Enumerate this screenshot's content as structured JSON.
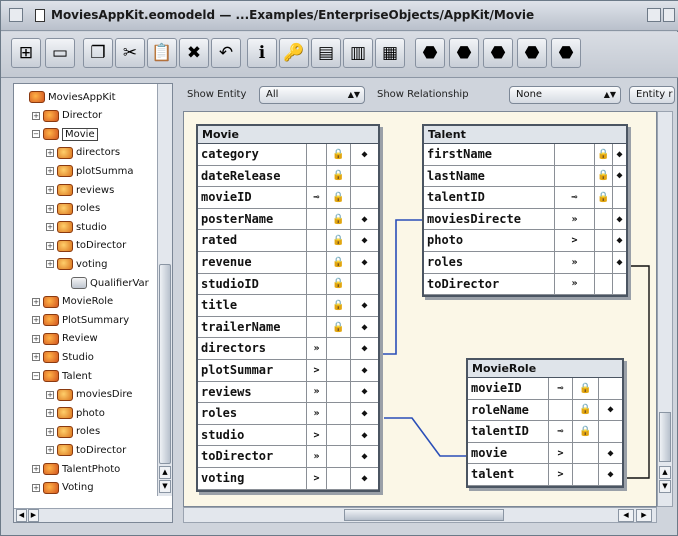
{
  "window": {
    "title": "MoviesAppKit.eomodeld — ...Examples/EnterpriseObjects/AppKit/Movie"
  },
  "toolbar": {
    "tools": [
      {
        "name": "browser-mode-icon",
        "glyph": "⊞"
      },
      {
        "name": "table-mode-icon",
        "glyph": "▭"
      },
      {
        "name": "copy-icon",
        "glyph": "❐"
      },
      {
        "name": "cut-icon",
        "glyph": "✂"
      },
      {
        "name": "paste-icon",
        "glyph": "📋"
      },
      {
        "name": "delete-icon",
        "glyph": "✖"
      },
      {
        "name": "undo-icon",
        "glyph": "↶"
      },
      {
        "name": "inspector-icon",
        "glyph": "ℹ"
      },
      {
        "name": "key-icon",
        "glyph": "🔑"
      },
      {
        "name": "table-edit-icon",
        "glyph": "▤"
      },
      {
        "name": "sql-icon",
        "glyph": "▥"
      },
      {
        "name": "data-browser-icon",
        "glyph": "▦"
      },
      {
        "name": "add-entity-icon",
        "glyph": "⬣"
      },
      {
        "name": "add-attribute-icon",
        "glyph": "⬣"
      },
      {
        "name": "add-relationship-icon",
        "glyph": "⬣"
      },
      {
        "name": "flatten-icon",
        "glyph": "⬣"
      },
      {
        "name": "fetch-spec-icon",
        "glyph": "⬣"
      }
    ]
  },
  "filters": {
    "entity_label": "Show Entity",
    "entity_value": "All",
    "relationship_label": "Show Relationship",
    "relationship_value": "None",
    "extra_value": "Entity r"
  },
  "tree": [
    {
      "label": "MoviesAppKit",
      "indent": 0,
      "exp": "",
      "icon": "model"
    },
    {
      "label": "Director",
      "indent": 1,
      "exp": "+",
      "icon": "entity"
    },
    {
      "label": "Movie",
      "indent": 1,
      "exp": "−",
      "icon": "entity",
      "selected": true
    },
    {
      "label": "directors",
      "indent": 2,
      "exp": "+",
      "icon": "attr"
    },
    {
      "label": "plotSumma",
      "indent": 2,
      "exp": "+",
      "icon": "attr"
    },
    {
      "label": "reviews",
      "indent": 2,
      "exp": "+",
      "icon": "attr"
    },
    {
      "label": "roles",
      "indent": 2,
      "exp": "+",
      "icon": "attr"
    },
    {
      "label": "studio",
      "indent": 2,
      "exp": "+",
      "icon": "attr"
    },
    {
      "label": "toDirector",
      "indent": 2,
      "exp": "+",
      "icon": "attr"
    },
    {
      "label": "voting",
      "indent": 2,
      "exp": "+",
      "icon": "attr"
    },
    {
      "label": "QualifierVar",
      "indent": 3,
      "exp": "",
      "icon": "qual"
    },
    {
      "label": "MovieRole",
      "indent": 1,
      "exp": "+",
      "icon": "entity"
    },
    {
      "label": "PlotSummary",
      "indent": 1,
      "exp": "+",
      "icon": "entity"
    },
    {
      "label": "Review",
      "indent": 1,
      "exp": "+",
      "icon": "entity"
    },
    {
      "label": "Studio",
      "indent": 1,
      "exp": "+",
      "icon": "entity"
    },
    {
      "label": "Talent",
      "indent": 1,
      "exp": "−",
      "icon": "entity"
    },
    {
      "label": "moviesDire",
      "indent": 2,
      "exp": "+",
      "icon": "attr"
    },
    {
      "label": "photo",
      "indent": 2,
      "exp": "+",
      "icon": "attr"
    },
    {
      "label": "roles",
      "indent": 2,
      "exp": "+",
      "icon": "attr"
    },
    {
      "label": "toDirector",
      "indent": 2,
      "exp": "+",
      "icon": "attr"
    },
    {
      "label": "TalentPhoto",
      "indent": 1,
      "exp": "+",
      "icon": "entity"
    },
    {
      "label": "Voting",
      "indent": 1,
      "exp": "+",
      "icon": "entity"
    }
  ],
  "entities": [
    {
      "id": "movie",
      "name": "Movie",
      "rows": [
        {
          "name": "category",
          "key": "",
          "lock": "🔒",
          "prop": "◆"
        },
        {
          "name": "dateRelease",
          "key": "",
          "lock": "🔒",
          "prop": ""
        },
        {
          "name": "movieID",
          "key": "⊸",
          "lock": "🔒",
          "prop": ""
        },
        {
          "name": "posterName",
          "key": "",
          "lock": "🔒",
          "prop": "◆"
        },
        {
          "name": "rated",
          "key": "",
          "lock": "🔒",
          "prop": "◆"
        },
        {
          "name": "revenue",
          "key": "",
          "lock": "🔒",
          "prop": "◆"
        },
        {
          "name": "studioID",
          "key": "",
          "lock": "🔒",
          "prop": ""
        },
        {
          "name": "title",
          "key": "",
          "lock": "🔒",
          "prop": "◆"
        },
        {
          "name": "trailerName",
          "key": "",
          "lock": "🔒",
          "prop": "◆"
        },
        {
          "name": "directors",
          "key": "»",
          "lock": "",
          "prop": "◆"
        },
        {
          "name": "plotSummar",
          "key": ">",
          "lock": "",
          "prop": "◆"
        },
        {
          "name": "reviews",
          "key": "»",
          "lock": "",
          "prop": "◆"
        },
        {
          "name": "roles",
          "key": "»",
          "lock": "",
          "prop": "◆"
        },
        {
          "name": "studio",
          "key": ">",
          "lock": "",
          "prop": "◆"
        },
        {
          "name": "toDirector",
          "key": "»",
          "lock": "",
          "prop": "◆"
        },
        {
          "name": "voting",
          "key": ">",
          "lock": "",
          "prop": "◆"
        }
      ]
    },
    {
      "id": "talent",
      "name": "Talent",
      "rows": [
        {
          "name": "firstName",
          "key": "",
          "lock": "🔒",
          "prop": "◆"
        },
        {
          "name": "lastName",
          "key": "",
          "lock": "🔒",
          "prop": "◆"
        },
        {
          "name": "talentID",
          "key": "⊸",
          "lock": "🔒",
          "prop": ""
        },
        {
          "name": "moviesDirecte",
          "key": "»",
          "lock": "",
          "prop": "◆"
        },
        {
          "name": "photo",
          "key": ">",
          "lock": "",
          "prop": "◆"
        },
        {
          "name": "roles",
          "key": "»",
          "lock": "",
          "prop": "◆"
        },
        {
          "name": "toDirector",
          "key": "»",
          "lock": "",
          "prop": ""
        }
      ]
    },
    {
      "id": "movierole",
      "name": "MovieRole",
      "rows": [
        {
          "name": "movieID",
          "key": "⊸",
          "lock": "🔒",
          "prop": ""
        },
        {
          "name": "roleName",
          "key": "",
          "lock": "🔒",
          "prop": "◆"
        },
        {
          "name": "talentID",
          "key": "⊸",
          "lock": "🔒",
          "prop": ""
        },
        {
          "name": "movie",
          "key": ">",
          "lock": "",
          "prop": "◆"
        },
        {
          "name": "talent",
          "key": ">",
          "lock": "",
          "prop": "◆"
        }
      ]
    }
  ]
}
